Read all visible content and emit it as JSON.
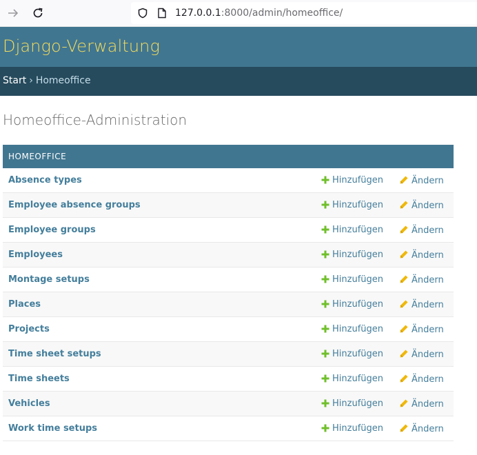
{
  "browser": {
    "url_host": "127.0.0.1",
    "url_rest": ":8000/admin/homeoffice/"
  },
  "header": {
    "site_name": "Django-Verwaltung"
  },
  "breadcrumbs": {
    "home": "Start",
    "separator": "›",
    "current": "Homeoffice"
  },
  "page": {
    "title": "Homeoffice-Administration"
  },
  "module": {
    "caption": "Homeoffice",
    "add_label": "Hinzufügen",
    "change_label": "Ändern",
    "models": [
      "Absence types",
      "Employee absence groups",
      "Employee groups",
      "Employees",
      "Montage setups",
      "Places",
      "Projects",
      "Time sheet setups",
      "Time sheets",
      "Vehicles",
      "Work time setups"
    ]
  },
  "colors": {
    "header_bg": "#417690",
    "site_name": "#f5dd5d",
    "breadcrumbs_bg": "#264b5d",
    "link": "#447e9b",
    "add_icon": "#70bf2b",
    "change_icon": "#efb80b"
  }
}
